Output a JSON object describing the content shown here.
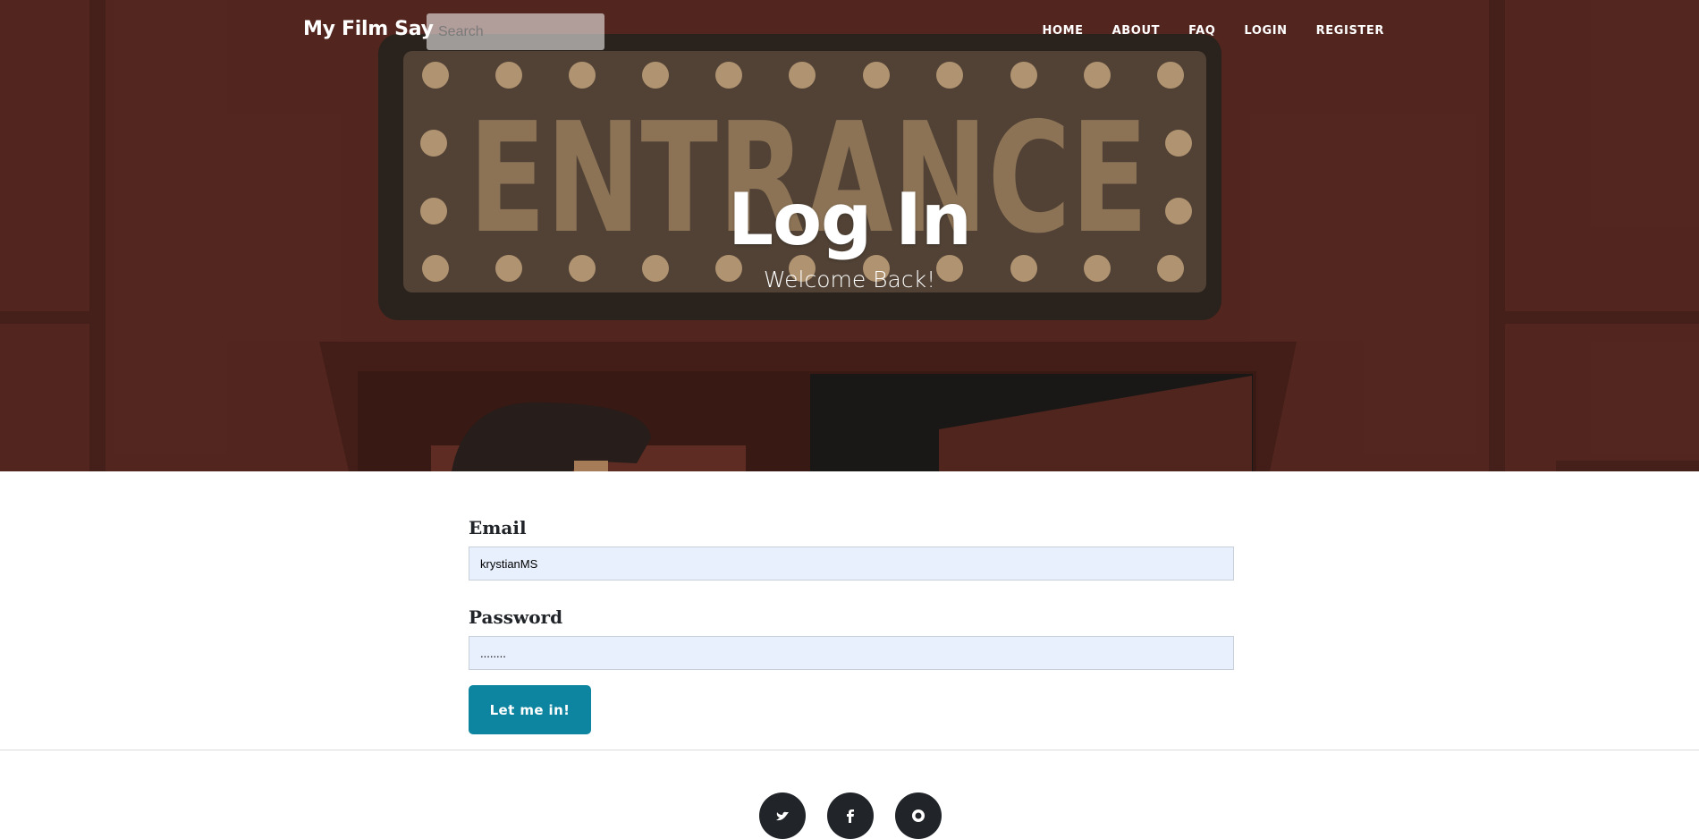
{
  "header": {
    "brand": "My Film Say",
    "search_placeholder": "Search",
    "nav": [
      "HOME",
      "ABOUT",
      "FAQ",
      "LOGIN",
      "REGISTER"
    ]
  },
  "hero": {
    "sign_text": "ENTRANCE",
    "title": "Log In",
    "subtitle": "Welcome Back!"
  },
  "form": {
    "email_label": "Email",
    "email_value": "krystianMS",
    "password_label": "Password",
    "password_value": "........",
    "submit_label": "Let me in!"
  },
  "footer": {
    "social_icons": [
      "twitter-icon",
      "facebook-icon",
      "github-icon"
    ]
  },
  "colors": {
    "hero_bg": "#5a2a22",
    "button": "#0e85a0",
    "input_bg": "#e8f0fe"
  }
}
